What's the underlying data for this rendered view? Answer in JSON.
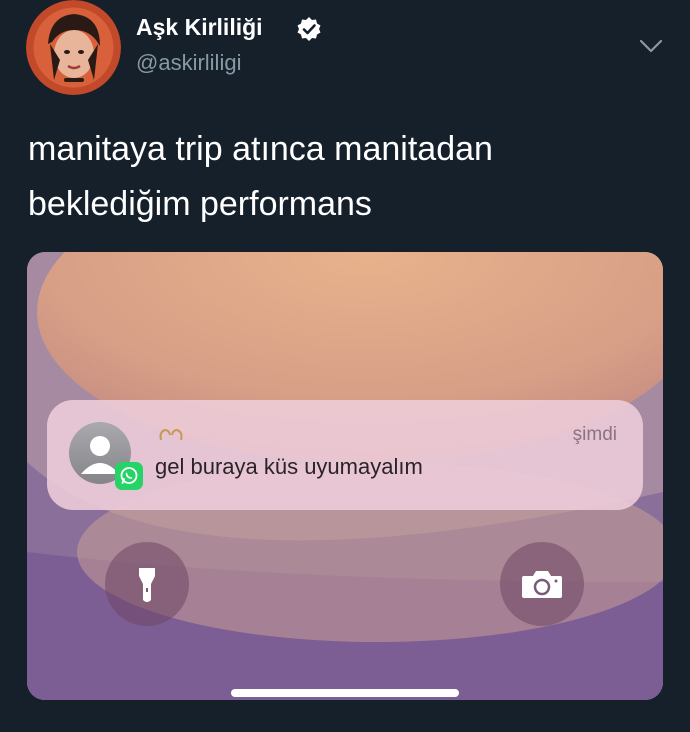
{
  "tweet": {
    "author_name": "Aşk Kirliliği",
    "handle": "@askirliligi",
    "text_lines": [
      "manitaya trip atınca manitadan",
      "beklediğim performans"
    ]
  },
  "media": {
    "notification": {
      "time": "şimdi",
      "message": "gel buraya küs uyumayalım",
      "app_icon": "whatsapp-icon",
      "emoji": "heart-hands-emoji"
    },
    "buttons": {
      "left_icon": "flashlight-icon",
      "right_icon": "camera-icon"
    }
  },
  "colors": {
    "background": "#15202b",
    "handle": "#8899a6",
    "whatsapp": "#25d366",
    "verified": "#ffffff"
  }
}
